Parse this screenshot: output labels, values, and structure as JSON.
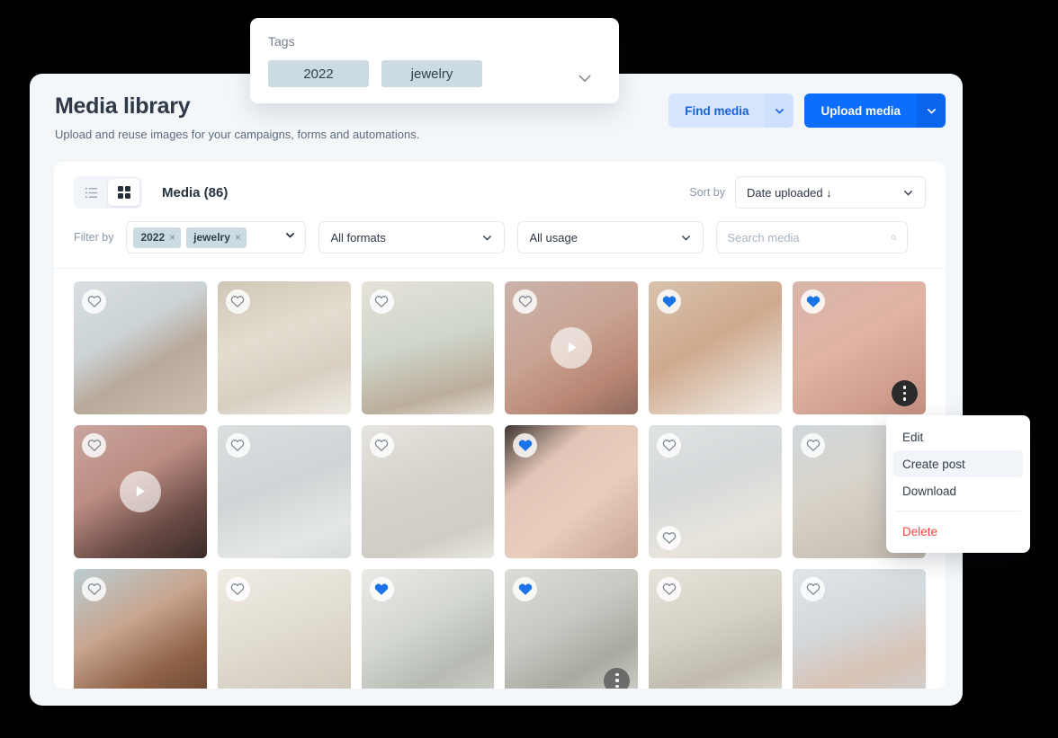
{
  "header": {
    "title": "Media library",
    "subtitle": "Upload and reuse images for your campaigns, forms and automations.",
    "find_media_label": "Find media",
    "upload_media_label": "Upload media"
  },
  "toolbar": {
    "media_count_label": "Media (86)",
    "sort_by_label": "Sort by",
    "sort_value": "Date uploaded ↓"
  },
  "filters": {
    "filter_by_label": "Filter by",
    "tags": [
      {
        "label": "2022",
        "remove": "×"
      },
      {
        "label": "jewelry",
        "remove": "×"
      }
    ],
    "formats_value": "All formats",
    "usage_value": "All usage",
    "search_value": "",
    "search_placeholder": "Search media"
  },
  "tags_popover": {
    "label": "Tags",
    "chips": [
      "2022",
      "jewelry"
    ]
  },
  "context_menu": {
    "items": [
      {
        "label": "Edit",
        "danger": false
      },
      {
        "label": "Create post",
        "danger": false
      },
      {
        "label": "Download",
        "danger": false
      },
      {
        "label": "Delete",
        "danger": true
      }
    ]
  },
  "colors": {
    "accent_blue": "#0d6efd",
    "secondary_blue_bg": "#d8e6fd",
    "chip_bg": "#ccdae2",
    "danger_red": "#f0453f",
    "panel_bg": "#f4f7fa",
    "card_bg": "#ffffff",
    "liked_heart": "#1a73e8"
  },
  "grid": {
    "items": [
      {
        "name": "woman-holding-flower-basket",
        "liked": false,
        "video": false,
        "menu": false,
        "second_heart": false,
        "bg": "linear-gradient(150deg,#d8dee2 0%,#ccd3d6 38%,#b8a99a 62%,#cdbfb2 100%)"
      },
      {
        "name": "hand-holding-dried-flowers",
        "liked": false,
        "video": false,
        "menu": false,
        "second_heart": false,
        "bg": "linear-gradient(160deg,#cfc6b5 0%,#e3ddd0 40%,#d8cfc2 70%,#efece4 100%)"
      },
      {
        "name": "bouquet-in-knit-sweater",
        "liked": false,
        "video": false,
        "menu": false,
        "second_heart": false,
        "bg": "linear-gradient(165deg,#e6e2d8 0%,#cfd6cb 45%,#bcae9c 80%,#e3ddd3 100%)"
      },
      {
        "name": "portrait-redhead-profile-video",
        "liked": false,
        "video": true,
        "menu": false,
        "second_heart": false,
        "bg": "linear-gradient(150deg,#cbb3ab 0%,#c9a393 45%,#b98675 75%,#8d6a5c 100%)"
      },
      {
        "name": "closeup-ear-gold-hoop-earrings",
        "liked": true,
        "video": false,
        "menu": false,
        "second_heart": false,
        "bg": "linear-gradient(150deg,#d8c2ad 0%,#cfa98e 45%,#e4d5c6 78%,#f2ece6 100%)"
      },
      {
        "name": "hands-with-rings-and-bracelet",
        "liked": true,
        "video": false,
        "menu": true,
        "second_heart": false,
        "bg": "linear-gradient(150deg,#d9b5ab 0%,#e0b3a3 45%,#cf9d8d 80%,#c59181 100%)"
      },
      {
        "name": "woman-black-top-profile-video",
        "liked": false,
        "video": true,
        "menu": false,
        "second_heart": false,
        "bg": "linear-gradient(150deg,#c9a59e 0%,#bb8d82 40%,#6b4b46 72%,#3a2b28 100%)"
      },
      {
        "name": "gold-chain-necklace-on-cloth",
        "liked": false,
        "video": false,
        "menu": false,
        "second_heart": false,
        "bg": "linear-gradient(160deg,#dadfe0 0%,#cfd5d6 45%,#e4e7e6 80%,#d6dbdb 100%)"
      },
      {
        "name": "rings-on-draped-fabric",
        "liked": false,
        "video": false,
        "menu": false,
        "second_heart": false,
        "bg": "linear-gradient(160deg,#e6e4de 0%,#d4d2ca 45%,#cfcdc5 78%,#e9e7e1 100%)"
      },
      {
        "name": "glass-of-water-on-pink-paper",
        "liked": true,
        "video": false,
        "menu": false,
        "second_heart": false,
        "bg": "linear-gradient(140deg,#3f3530 0%,#e2c5b6 30%,#e9cdbd 60%,#c8a493 100%)"
      },
      {
        "name": "gold-rings-on-mirror-tray",
        "liked": false,
        "video": false,
        "menu": false,
        "second_heart": true,
        "bg": "linear-gradient(160deg,#dfe3e4 0%,#d5d9da 40%,#e8e4dd 75%,#dcd8d2 100%)"
      },
      {
        "name": "knit-sweater-closeup",
        "liked": false,
        "video": false,
        "menu": false,
        "second_heart": false,
        "bg": "linear-gradient(160deg,#cfd8dc 0%,#d9d4cb 40%,#cdc6ba 75%,#c2bbaf 100%)"
      },
      {
        "name": "hand-touching-hoop-earring",
        "liked": false,
        "video": false,
        "menu": false,
        "second_heart": false,
        "bg": "linear-gradient(150deg,#b9cdd2 0%,#c8a58f 40%,#8e6247 72%,#6b4632 100%)"
      },
      {
        "name": "gold-chains-on-white-textile",
        "liked": false,
        "video": false,
        "menu": false,
        "second_heart": false,
        "bg": "linear-gradient(160deg,#efece4 0%,#e2ddd2 45%,#d6cfc2 78%,#cdc6b9 100%)"
      },
      {
        "name": "ceramic-cups-with-shadow",
        "liked": true,
        "video": false,
        "menu": false,
        "second_heart": false,
        "bg": "linear-gradient(150deg,#e9eae6 0%,#d4d7d1 42%,#b7bbb4 72%,#cfd2cb 100%)"
      },
      {
        "name": "pouring-sugar-into-ceramic-jar",
        "liked": true,
        "video": false,
        "menu": true,
        "second_heart": false,
        "bg": "linear-gradient(150deg,#dcdcd8 0%,#c9c9c3 40%,#aaa9a2 70%,#d3d2cc 100%)"
      },
      {
        "name": "ceramic-jars-with-lid",
        "liked": false,
        "video": false,
        "menu": false,
        "second_heart": false,
        "bg": "linear-gradient(160deg,#e6e3da 0%,#d5d1c6 42%,#c0bbae 72%,#e2ded4 100%)"
      },
      {
        "name": "rose-gold-bracelet-on-sheet",
        "liked": false,
        "video": false,
        "menu": false,
        "second_heart": false,
        "bg": "linear-gradient(160deg,#dfe5e8 0%,#d3d9dc 40%,#d8c2b4 72%,#cdd3d6 100%)"
      }
    ]
  }
}
